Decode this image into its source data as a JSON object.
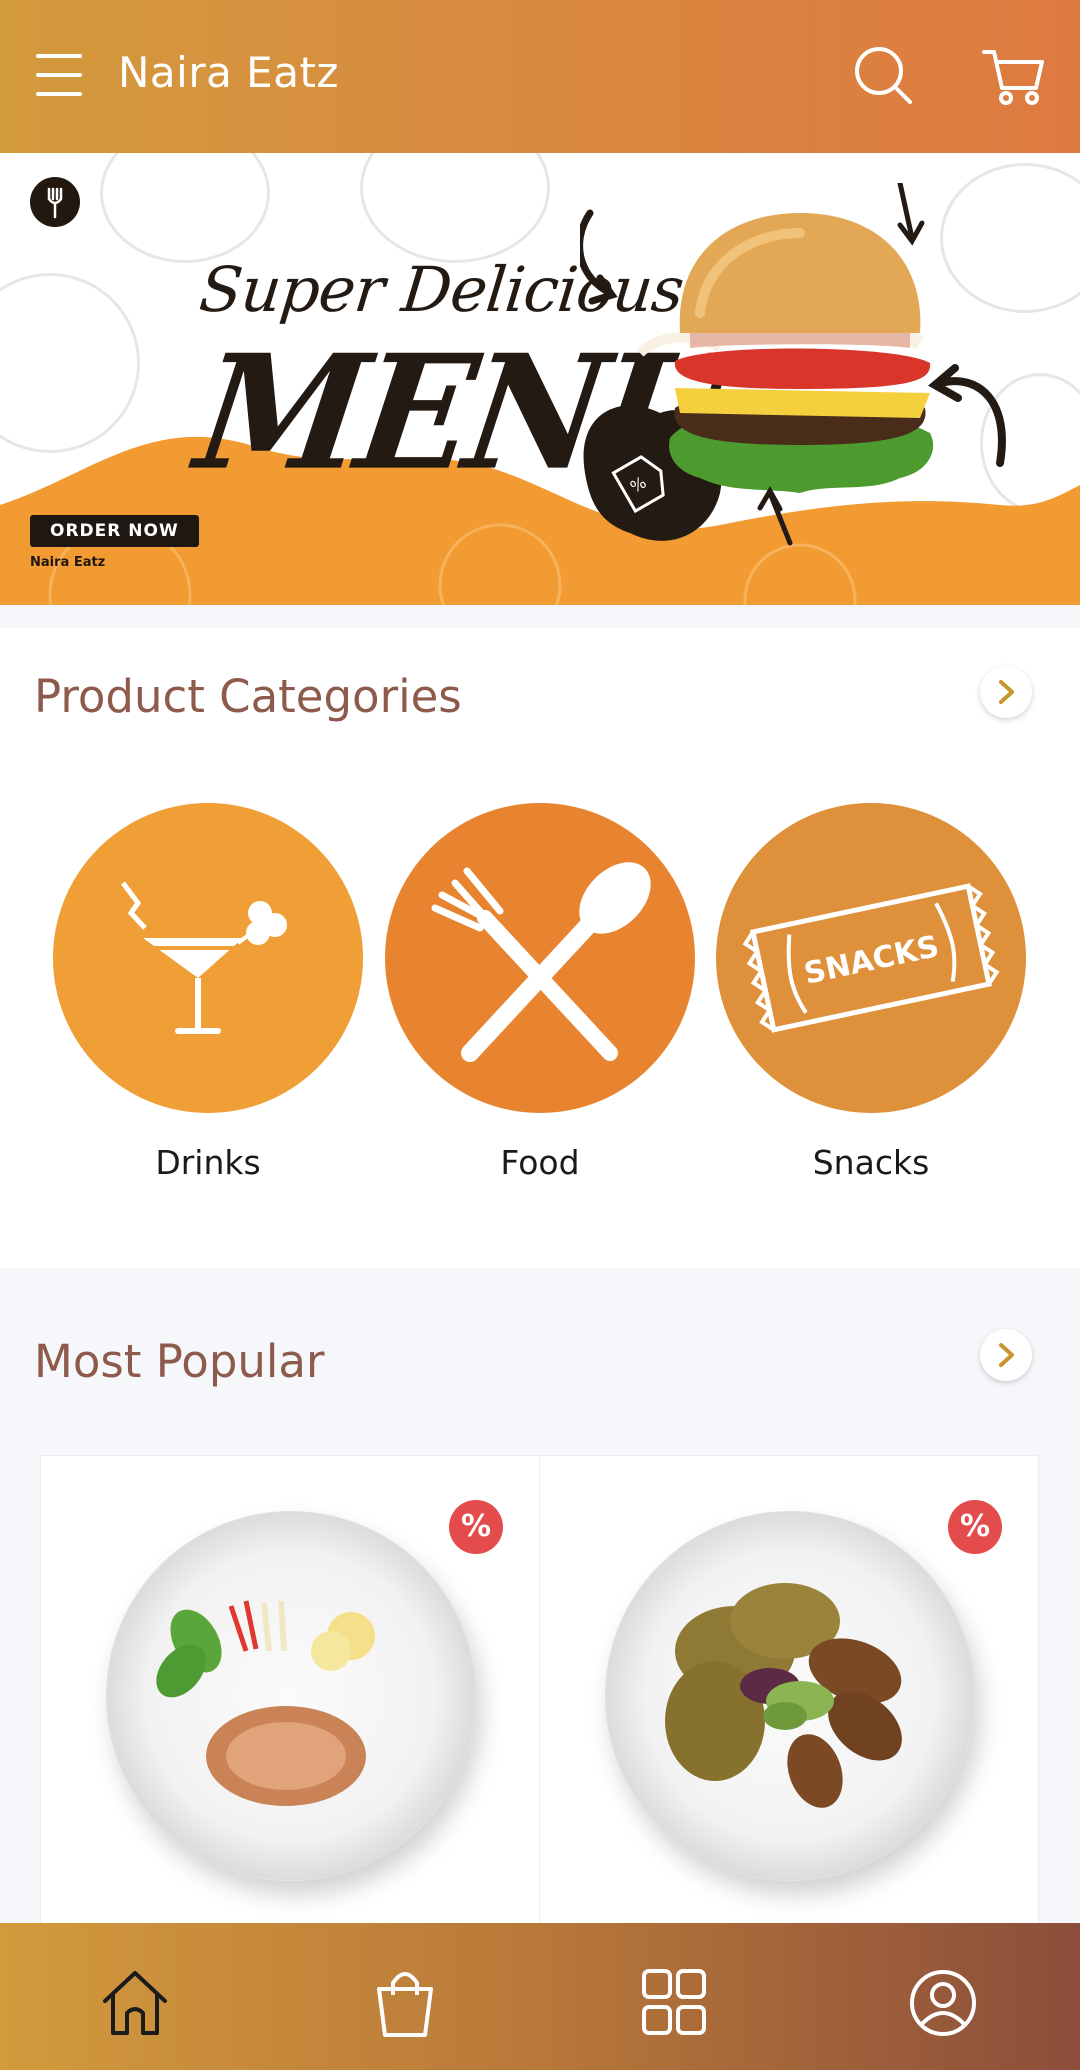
{
  "header": {
    "title": "Naira Eatz",
    "menu_icon": "hamburger-menu-icon",
    "search_icon": "search-icon",
    "cart_icon": "shopping-cart-icon"
  },
  "banner": {
    "headline_line1": "Super Delicious",
    "headline_line2": "MENU",
    "cta_label": "ORDER NOW",
    "brand_label": "Naira Eatz"
  },
  "categories": {
    "title": "Product Categories",
    "items": [
      {
        "label": "Drinks",
        "icon": "cocktail-icon",
        "color": "#f09e36"
      },
      {
        "label": "Food",
        "icon": "fork-spoon-icon",
        "color": "#e8842f"
      },
      {
        "label": "Snacks",
        "icon": "snack-pack-icon",
        "icon_text": "SNACKS",
        "color": "#de903a"
      }
    ]
  },
  "popular": {
    "title": "Most Popular",
    "items": [
      {
        "badge": "%"
      },
      {
        "badge": "%"
      }
    ]
  },
  "bottom_nav": {
    "items": [
      "home-icon",
      "shopping-bag-icon",
      "categories-grid-icon",
      "profile-icon"
    ]
  },
  "colors": {
    "accent": "#d98740",
    "title_brown": "#8d5a4b",
    "badge_red": "#e44b4b",
    "banner_orange": "#f29b32"
  }
}
